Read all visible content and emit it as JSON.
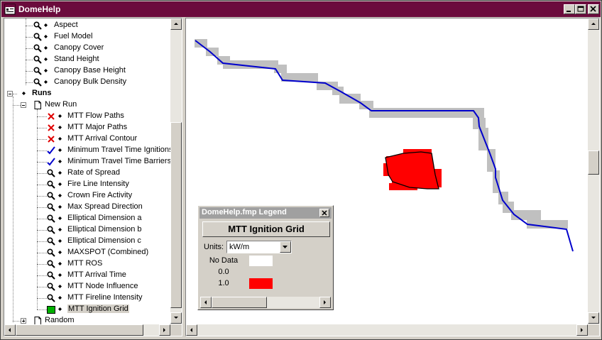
{
  "window": {
    "title": "DomeHelp"
  },
  "tree": {
    "items": [
      {
        "label": "Aspect",
        "icon": "magnifier-icon",
        "name": "tree-item-aspect"
      },
      {
        "label": "Fuel Model",
        "icon": "magnifier-icon",
        "name": "tree-item-fuel-model"
      },
      {
        "label": "Canopy Cover",
        "icon": "magnifier-icon",
        "name": "tree-item-canopy-cover"
      },
      {
        "label": "Stand Height",
        "icon": "magnifier-icon",
        "name": "tree-item-stand-height"
      },
      {
        "label": "Canopy Base Height",
        "icon": "magnifier-icon",
        "name": "tree-item-canopy-base-height"
      },
      {
        "label": "Canopy Bulk Density",
        "icon": "magnifier-icon",
        "name": "tree-item-canopy-bulk-density"
      }
    ],
    "runs_label": "Runs",
    "new_run_label": "New Run",
    "run_items": [
      {
        "label": "MTT Flow Paths",
        "icon": "red-x-icon"
      },
      {
        "label": "MTT Major Paths",
        "icon": "red-x-icon"
      },
      {
        "label": "MTT Arrival Contour",
        "icon": "red-x-icon"
      },
      {
        "label": "Minimum Travel Time Ignitions",
        "icon": "checkmark-icon"
      },
      {
        "label": "Minimum Travel Time Barriers",
        "icon": "checkmark-icon"
      },
      {
        "label": "Rate of Spread",
        "icon": "magnifier-icon"
      },
      {
        "label": "Fire Line Intensity",
        "icon": "magnifier-icon"
      },
      {
        "label": "Crown Fire Activity",
        "icon": "magnifier-icon"
      },
      {
        "label": "Max Spread Direction",
        "icon": "magnifier-icon"
      },
      {
        "label": "Elliptical Dimension a",
        "icon": "magnifier-icon"
      },
      {
        "label": "Elliptical Dimension b",
        "icon": "magnifier-icon"
      },
      {
        "label": "Elliptical Dimension c",
        "icon": "magnifier-icon"
      },
      {
        "label": "MAXSPOT (Combined)",
        "icon": "magnifier-icon"
      },
      {
        "label": "MTT ROS",
        "icon": "magnifier-icon"
      },
      {
        "label": "MTT Arrival Time",
        "icon": "magnifier-icon"
      },
      {
        "label": "MTT Node Influence",
        "icon": "magnifier-icon"
      },
      {
        "label": "MTT Fireline Intensity",
        "icon": "magnifier-icon"
      },
      {
        "label": "MTT Ignition Grid",
        "icon": "green-square-icon"
      }
    ],
    "random_label": "Random"
  },
  "legend": {
    "title": "DomeHelp.fmp Legend",
    "button_label": "MTT Ignition Grid",
    "units_label": "Units:",
    "units_value": "kW/m",
    "rows": [
      {
        "label": "No Data",
        "color": "#ffffff"
      },
      {
        "label": "0.0",
        "color": "#d4d0c8"
      },
      {
        "label": "1.0",
        "color": "#ff0000"
      }
    ]
  },
  "map": {
    "barrier_color": "#0000cc",
    "shadow_color": "#c0c0c0",
    "ignition_color": "#ff0000"
  }
}
